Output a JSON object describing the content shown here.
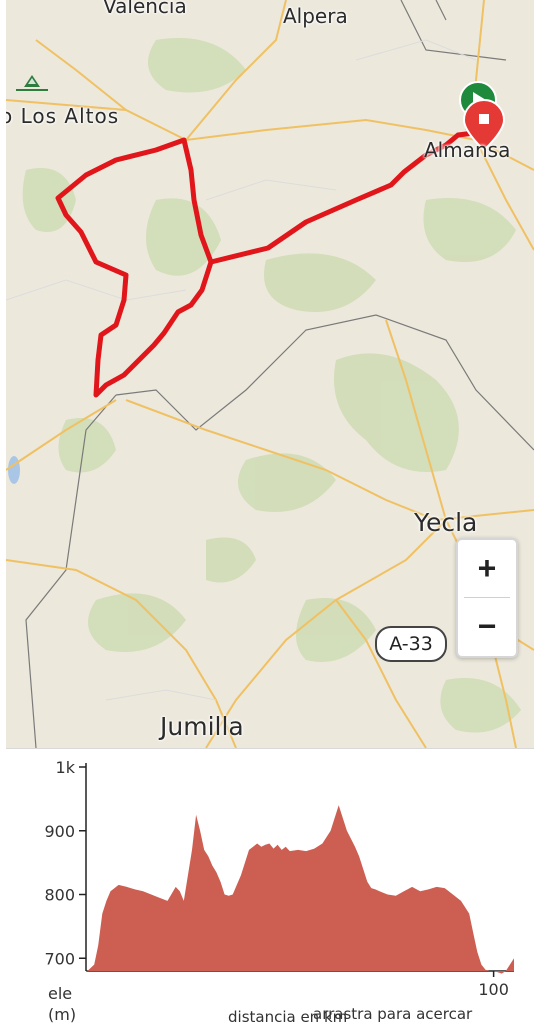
{
  "map": {
    "place_labels": {
      "valencia": "Valencia",
      "alpera": "Alpera",
      "los_altos": "o Los Altos",
      "almansa": "Almansa",
      "yecla": "Yecla",
      "jumilla": "Jumilla"
    },
    "road_shield": "A-33",
    "zoom_in_label": "+",
    "zoom_out_label": "−",
    "route_color": "#e0161b",
    "start_marker_color": "#1f8a3b",
    "end_marker_color": "#e53935"
  },
  "elevation": {
    "y_axis_label": "ele",
    "y_axis_unit": "(m)",
    "x_axis_label": "distancia en km",
    "hint_text": "arrastra para acercar",
    "fill_color": "#cc5f52"
  },
  "chart_data": {
    "type": "area",
    "xlabel": "distancia en km",
    "ylabel": "ele (m)",
    "ylim": [
      680,
      1000
    ],
    "xlim": [
      0,
      105
    ],
    "y_ticks": [
      {
        "value": 1000,
        "label": "1k"
      },
      {
        "value": 900,
        "label": "900"
      },
      {
        "value": 800,
        "label": "800"
      },
      {
        "value": 700,
        "label": "700"
      }
    ],
    "x_ticks": [
      {
        "value": 100,
        "label": "100"
      }
    ],
    "series": [
      {
        "x": [
          0,
          2,
          3,
          4,
          5,
          6,
          7,
          8,
          10,
          12,
          14,
          16,
          18,
          20,
          22,
          23,
          24,
          25,
          26,
          27,
          28,
          29,
          30,
          31,
          32,
          33,
          34,
          35,
          36,
          37,
          38,
          40,
          42,
          43,
          44,
          45,
          46,
          47,
          48,
          49,
          50,
          52,
          54,
          56,
          58,
          60,
          62,
          64,
          66,
          67,
          68,
          69,
          70,
          71,
          72,
          74,
          76,
          78,
          80,
          82,
          84,
          86,
          88,
          90,
          92,
          94,
          95,
          96,
          97,
          98,
          99,
          100,
          101,
          102,
          103,
          104,
          105
        ],
        "values": [
          678,
          690,
          720,
          770,
          790,
          805,
          810,
          815,
          812,
          808,
          805,
          800,
          795,
          790,
          812,
          805,
          790,
          830,
          870,
          925,
          900,
          870,
          860,
          845,
          835,
          820,
          800,
          798,
          800,
          815,
          830,
          870,
          880,
          875,
          878,
          880,
          872,
          878,
          870,
          875,
          868,
          870,
          868,
          872,
          880,
          900,
          940,
          900,
          875,
          860,
          840,
          820,
          810,
          808,
          805,
          800,
          798,
          805,
          812,
          805,
          808,
          812,
          810,
          800,
          790,
          770,
          740,
          710,
          690,
          682,
          680,
          680,
          678,
          676,
          680,
          690,
          700
        ]
      }
    ]
  }
}
